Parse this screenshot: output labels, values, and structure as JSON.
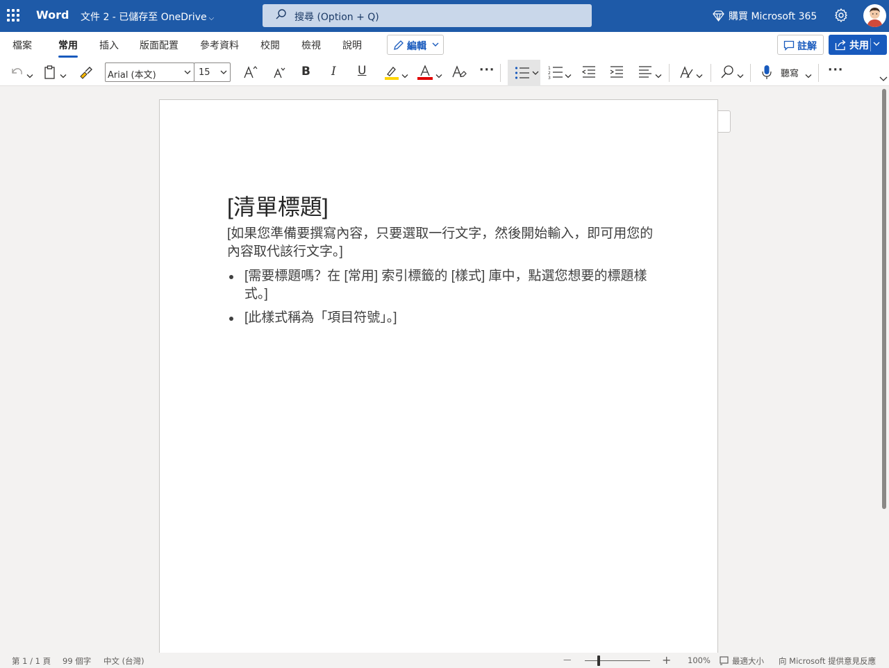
{
  "titlebar": {
    "app_name": "Word",
    "doc_name": "文件 2 - 已儲存至 OneDrive",
    "search_placeholder": "搜尋 (Option + Q)",
    "buy_label": "購買 Microsoft 365"
  },
  "tabs": [
    {
      "label": "檔案",
      "active": false
    },
    {
      "label": "常用",
      "active": true
    },
    {
      "label": "插入",
      "active": false
    },
    {
      "label": "版面配置",
      "active": false
    },
    {
      "label": "參考資料",
      "active": false
    },
    {
      "label": "校閱",
      "active": false
    },
    {
      "label": "檢視",
      "active": false
    },
    {
      "label": "說明",
      "active": false
    }
  ],
  "tabbar": {
    "edit_label": "編輯",
    "comment_label": "註解",
    "share_label": "共用"
  },
  "toolbar": {
    "font_name": "Arial (本文)",
    "font_size": "15",
    "bold": "B",
    "italic": "I",
    "underline": "U",
    "dictate_label": "聽寫",
    "more": "···"
  },
  "document": {
    "title": "[清單標題]",
    "paragraph": "[如果您準備要撰寫內容，只要選取一行文字，然後開始輸入，即可用您的內容取代該行文字。]",
    "bullets": [
      "[需要標題嗎？在 [常用] 索引標籤的 [樣式] 庫中，點選您想要的標題樣式。]",
      "[此樣式稱為「項目符號」。]"
    ]
  },
  "statusbar": {
    "page": "第 1 / 1 頁",
    "words": "99 個字",
    "language": "中文 (台灣)",
    "zoom_minus": "—",
    "zoom_plus": "+",
    "zoom": "100%",
    "fit": "最適大小",
    "feedback": "向 Microsoft 提供意見反應"
  },
  "colors": {
    "brand": "#1e5aa8",
    "accent": "#185abd",
    "highlight": "#ffd500",
    "font_color": "#e00000"
  }
}
